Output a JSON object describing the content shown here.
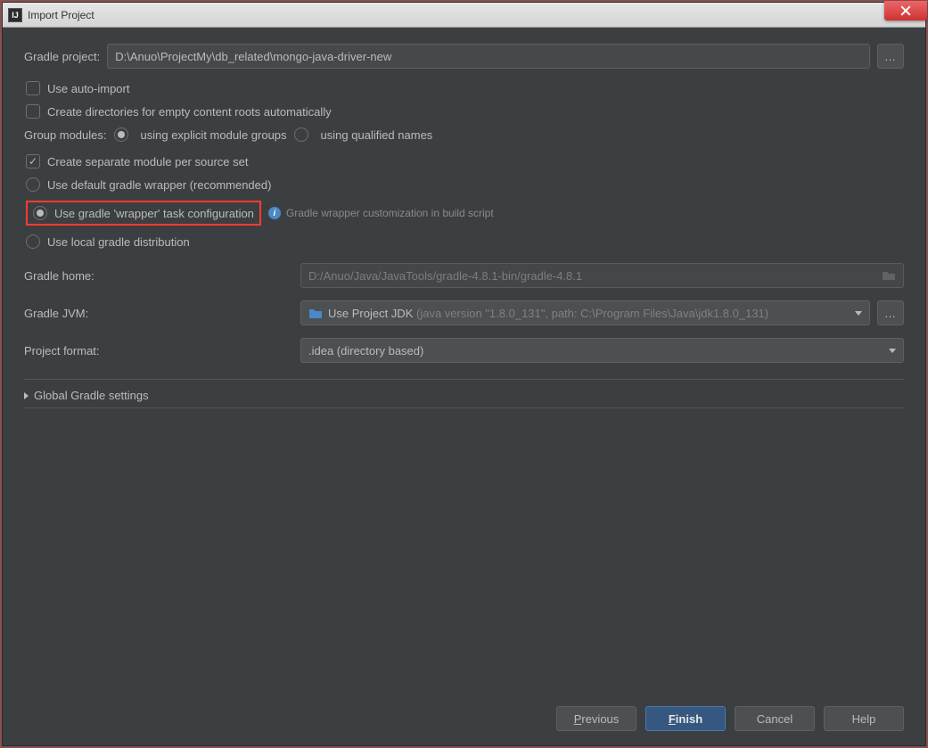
{
  "window_title": "Import Project",
  "gradle_project": {
    "label": "Gradle project:",
    "value": "D:\\Anuo\\ProjectMy\\db_related\\mongo-java-driver-new"
  },
  "auto_import_label": "Use auto-import",
  "create_dirs_label": "Create directories for empty content roots automatically",
  "group_modules": {
    "label": "Group modules:",
    "opt1": "using explicit module groups",
    "opt2": "using qualified names"
  },
  "separate_module_label": "Create separate module per source set",
  "wrapper_default_label": "Use default gradle wrapper (recommended)",
  "wrapper_task_label": "Use gradle 'wrapper' task configuration",
  "wrapper_hint": "Gradle wrapper customization in build script",
  "local_dist_label": "Use local gradle distribution",
  "gradle_home": {
    "label": "Gradle home:",
    "value": "D:/Anuo/Java/JavaTools/gradle-4.8.1-bin/gradle-4.8.1"
  },
  "gradle_jvm": {
    "label": "Gradle JVM:",
    "value": "Use Project JDK",
    "detail": "(java version \"1.8.0_131\", path: C:\\Program Files\\Java\\jdk1.8.0_131)"
  },
  "project_format": {
    "label": "Project format:",
    "value": ".idea (directory based)"
  },
  "global_settings_label": "Global Gradle settings",
  "buttons": {
    "previous": "Previous",
    "finish": "Finish",
    "cancel": "Cancel",
    "help": "Help"
  }
}
